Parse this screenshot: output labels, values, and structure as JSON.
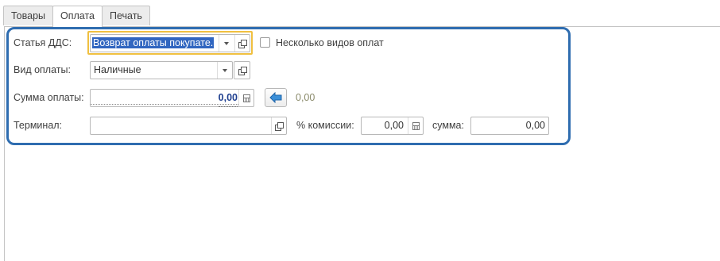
{
  "tabs": [
    "Товары",
    "Оплата",
    "Печать"
  ],
  "active_tab": 1,
  "form": {
    "dds_label": "Статья ДДС:",
    "dds_value": "Возврат оплаты покупате.",
    "multi_label": "Несколько видов оплат",
    "multi_checked": false,
    "payment_type_label": "Вид оплаты:",
    "payment_type_value": "Наличные",
    "amount_label": "Сумма оплаты:",
    "amount_value": "0,00",
    "amount_secondary": "0,00",
    "terminal_label": "Терминал:",
    "terminal_value": "",
    "commission_label": "% комиссии:",
    "commission_value": "0,00",
    "sum_label": "сумма:",
    "sum_value": "0,00"
  },
  "colors": {
    "frame": "#2f6db0",
    "focus": "#f0c040",
    "arrow": "#3a8fd8",
    "selection": "#3166c0"
  },
  "icons": {
    "dropdown": "chevron-down-icon",
    "open": "open-form-icon",
    "calculator": "calculator-icon",
    "fill": "arrow-left-icon"
  }
}
